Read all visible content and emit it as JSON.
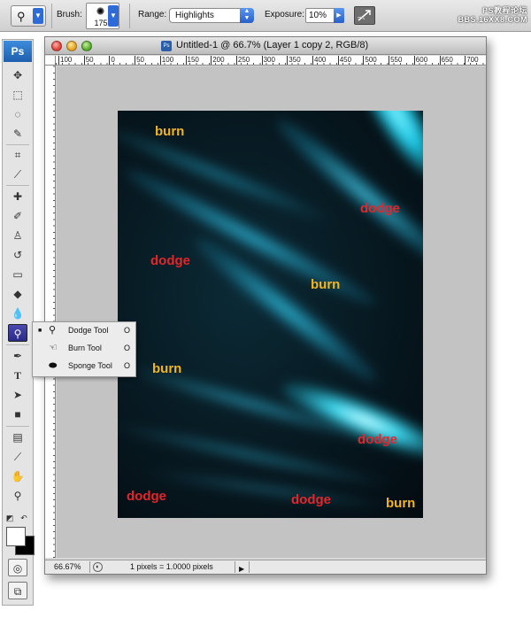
{
  "options_bar": {
    "tool_icon": "dodge-tool-icon",
    "brush_label": "Brush:",
    "brush_size": "175",
    "range_label": "Range:",
    "range_value": "Highlights",
    "exposure_label": "Exposure:",
    "exposure_value": "10%",
    "airbrush_icon": "airbrush-icon",
    "watermark_line1": "PS教程论坛",
    "watermark_line2": "BBS.16XX8.COM"
  },
  "toolbox": {
    "logo": "Ps",
    "tools": [
      "move-tool",
      "marquee-tool",
      "lasso-tool",
      "magic-wand-tool",
      "crop-tool",
      "slice-tool",
      "healing-brush-tool",
      "brush-tool",
      "clone-stamp-tool",
      "history-brush-tool",
      "eraser-tool",
      "paint-bucket-tool",
      "blur-tool",
      "dodge-tool",
      "pen-tool",
      "type-tool",
      "path-selection-tool",
      "shape-tool",
      "notes-tool",
      "eyedropper-tool",
      "hand-tool",
      "zoom-tool"
    ],
    "active_tool": "dodge-tool",
    "foreground_color": "#ffffff",
    "background_color": "#000000"
  },
  "flyout": {
    "items": [
      {
        "label": "Dodge Tool",
        "shortcut": "O",
        "icon": "dodge-icon",
        "selected": true
      },
      {
        "label": "Burn Tool",
        "shortcut": "O",
        "icon": "burn-icon",
        "selected": false
      },
      {
        "label": "Sponge Tool",
        "shortcut": "O",
        "icon": "sponge-icon",
        "selected": false
      }
    ]
  },
  "document": {
    "title": "Untitled-1 @ 66.7% (Layer 1 copy 2, RGB/8)",
    "ruler_labels": [
      "100",
      "50",
      "0",
      "50",
      "100",
      "150",
      "200",
      "250",
      "300",
      "350",
      "400",
      "450",
      "500",
      "550",
      "600",
      "650",
      "700"
    ],
    "zoom": "66.67%",
    "status_info": "1 pixels = 1.0000 pixels",
    "canvas_bg_color": "#c3c3c3"
  },
  "image": {
    "annotations": [
      {
        "text": "burn",
        "kind": "burn"
      },
      {
        "text": "dodge",
        "kind": "dodge"
      },
      {
        "text": "dodge",
        "kind": "dodge"
      },
      {
        "text": "burn",
        "kind": "burn"
      },
      {
        "text": "burn",
        "kind": "burn"
      },
      {
        "text": "dodge",
        "kind": "dodge"
      },
      {
        "text": "dodge",
        "kind": "dodge"
      },
      {
        "text": "dodge",
        "kind": "dodge"
      },
      {
        "text": "burn",
        "kind": "burn"
      }
    ],
    "burn_color": "#f2b51f",
    "dodge_color": "#e3262b",
    "streak_color": "#1ec8e6"
  }
}
